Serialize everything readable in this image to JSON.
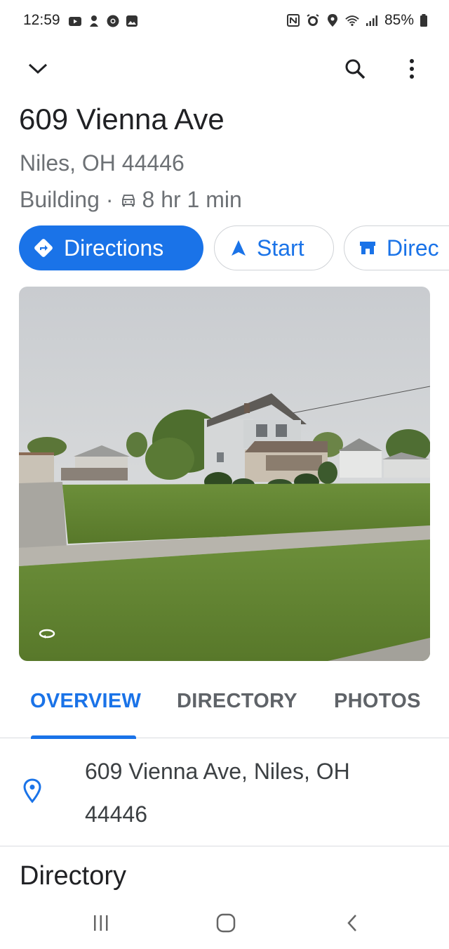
{
  "status_bar": {
    "time": "12:59",
    "battery": "85%",
    "left_icons": [
      "youtube-icon",
      "notification-icon",
      "chrome-icon",
      "gallery-icon"
    ],
    "right_icons": [
      "nfc-icon",
      "alarm-icon",
      "location-icon",
      "wifi-icon",
      "signal-icon",
      "battery-icon"
    ]
  },
  "topbar": {
    "icons": [
      "chevron-down-icon",
      "search-icon",
      "more-vert-icon"
    ]
  },
  "place": {
    "title": "609 Vienna Ave",
    "subtitle": "Niles, OH 44446",
    "category": "Building",
    "separator": "·",
    "drive_time": "8 hr 1 min"
  },
  "chips": {
    "directions": "Directions",
    "start": "Start",
    "directory": "Direc"
  },
  "tabs": [
    {
      "label": "OVERVIEW",
      "active": true
    },
    {
      "label": "DIRECTORY",
      "active": false
    },
    {
      "label": "PHOTOS",
      "active": false
    }
  ],
  "address": {
    "line1": "609 Vienna Ave, Niles, OH",
    "line2": "44446"
  },
  "section": {
    "title": "Directory"
  },
  "nav": {
    "icons": [
      "recents-icon",
      "home-icon",
      "back-icon"
    ]
  },
  "colors": {
    "accent": "#1a73e8",
    "secondary_text": "#6d7175",
    "divider": "#dadce0"
  }
}
